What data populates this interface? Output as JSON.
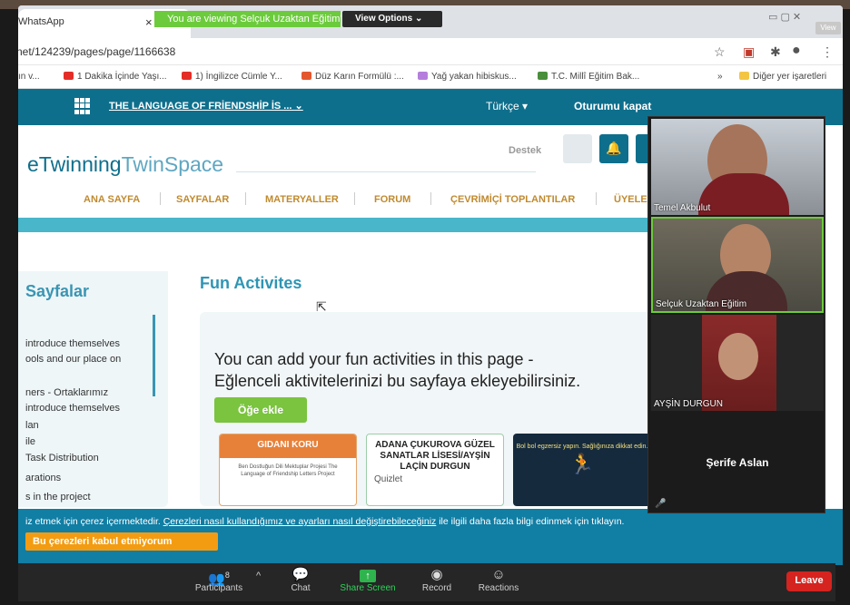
{
  "share_banner": {
    "text": "You are viewing Selçuk Uzaktan Eğitim's screen",
    "view_options": "View Options ⌄"
  },
  "browser": {
    "tab_title": "WhatsApp",
    "tab_close": "×",
    "view_button": "View",
    "url": "net/124239/pages/page/1166638",
    "bookmarks": [
      "ın v...",
      "1 Dakika İçinde Yaşı...",
      "1) İngilizce Cümle Y...",
      "Düz Karın Formülü :...",
      "Yağ yakan hibiskus...",
      "T.C. Millî Eğitim Bak...",
      "»",
      "Diğer yer işaretleri"
    ],
    "icons": [
      "star-icon",
      "extension-icon",
      "puzzle-icon",
      "profile-icon",
      "kebab-menu-icon"
    ]
  },
  "site": {
    "project_title": "THE LANGUAGE OF FRİENDSHİP İS ...",
    "project_chevron": "⌄",
    "language": "Türkçe",
    "language_caret": "▾",
    "logout": "Oturumu kapat",
    "logo_a": "eTwinning",
    "logo_b": "TwinSpace",
    "support": "Destek",
    "menu": [
      "ANA SAYFA",
      "SAYFALAR",
      "MATERYALLER",
      "FORUM",
      "ÇEVRİMİÇİ TOPLANTILAR",
      "ÜYELE"
    ]
  },
  "sidebar": {
    "title": "Sayfalar",
    "items": [
      "introduce themselves",
      "ools and our place on",
      "ners - Ortaklarımız",
      "introduce themselves",
      "lan",
      "ile",
      "Task Distribution",
      "arations",
      "s in the project"
    ]
  },
  "main": {
    "page_title": "Fun Activites",
    "intro_line1": "You can add your fun activities in this page -",
    "intro_line2": "Eğlenceli aktivitelerinizi bu sayfaya ekleyebilirsiniz.",
    "add_button": "Öğe ekle",
    "tiles": [
      {
        "header": "GIDANI KORU",
        "body": "Ben Dostluğun Dili Mektuplar Projesi The Language of Friendship Letters Project"
      },
      {
        "title": "ADANA ÇUKUROVA GÜZEL SANATLAR LİSESİ/AYŞİN LAÇİN DURGUN",
        "type": "Quizlet"
      },
      {
        "text": "Bol bol egzersiz yapın. Sağlığınıza dikkat edin."
      }
    ]
  },
  "cookie": {
    "text_start": "iz etmek için çerez içermektedir.",
    "link": "Çerezleri nasıl kullandığımız ve ayarları nasıl değiştirebileceğiniz",
    "text_end": "ile ilgili daha fazla bilgi edinmek için tıklayın.",
    "reject_button": "Bu çerezleri kabul etmiyorum"
  },
  "participants_video": [
    {
      "name": "Temel Akbulut"
    },
    {
      "name": "Selçuk Uzaktan Eğitim"
    },
    {
      "name": "AYŞİN DURGUN"
    },
    {
      "name": "Şerife Aslan"
    }
  ],
  "toolbar": {
    "participants_count": "8",
    "caret": "^",
    "items": [
      "Participants",
      "Chat",
      "Share Screen",
      "Record",
      "Reactions"
    ],
    "leave": "Leave"
  },
  "colors": {
    "zoom_green": "#6ccb3c",
    "twinning_teal": "#0e6f8c",
    "cookie_blue": "#117ea4",
    "leave_red": "#d5231f",
    "add_green": "#7ac43f"
  }
}
